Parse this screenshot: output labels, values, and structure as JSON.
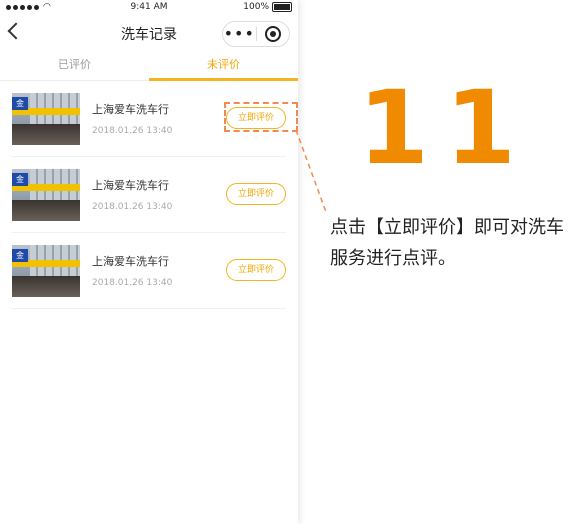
{
  "status_bar": {
    "time": "9:41 AM",
    "battery": "100%"
  },
  "nav": {
    "title": "洗车记录"
  },
  "tabs": [
    {
      "label": "已评价",
      "active": false
    },
    {
      "label": "未评价",
      "active": true
    }
  ],
  "records": [
    {
      "shop": "上海爱车洗车行",
      "date": "2018.01.26 13:40",
      "button": "立即评价"
    },
    {
      "shop": "上海爱车洗车行",
      "date": "2018.01.26 13:40",
      "button": "立即评价"
    },
    {
      "shop": "上海爱车洗车行",
      "date": "2018.01.26 13:40",
      "button": "立即评价"
    }
  ],
  "annotation": {
    "step_number": "11",
    "caption": "点击【立即评价】即可对洗车服务进行点评。"
  },
  "colors": {
    "accent": "#f5b41f",
    "step": "#f08a00",
    "callout": "#f28a50"
  },
  "icons": {
    "thumb_logo": "金"
  }
}
